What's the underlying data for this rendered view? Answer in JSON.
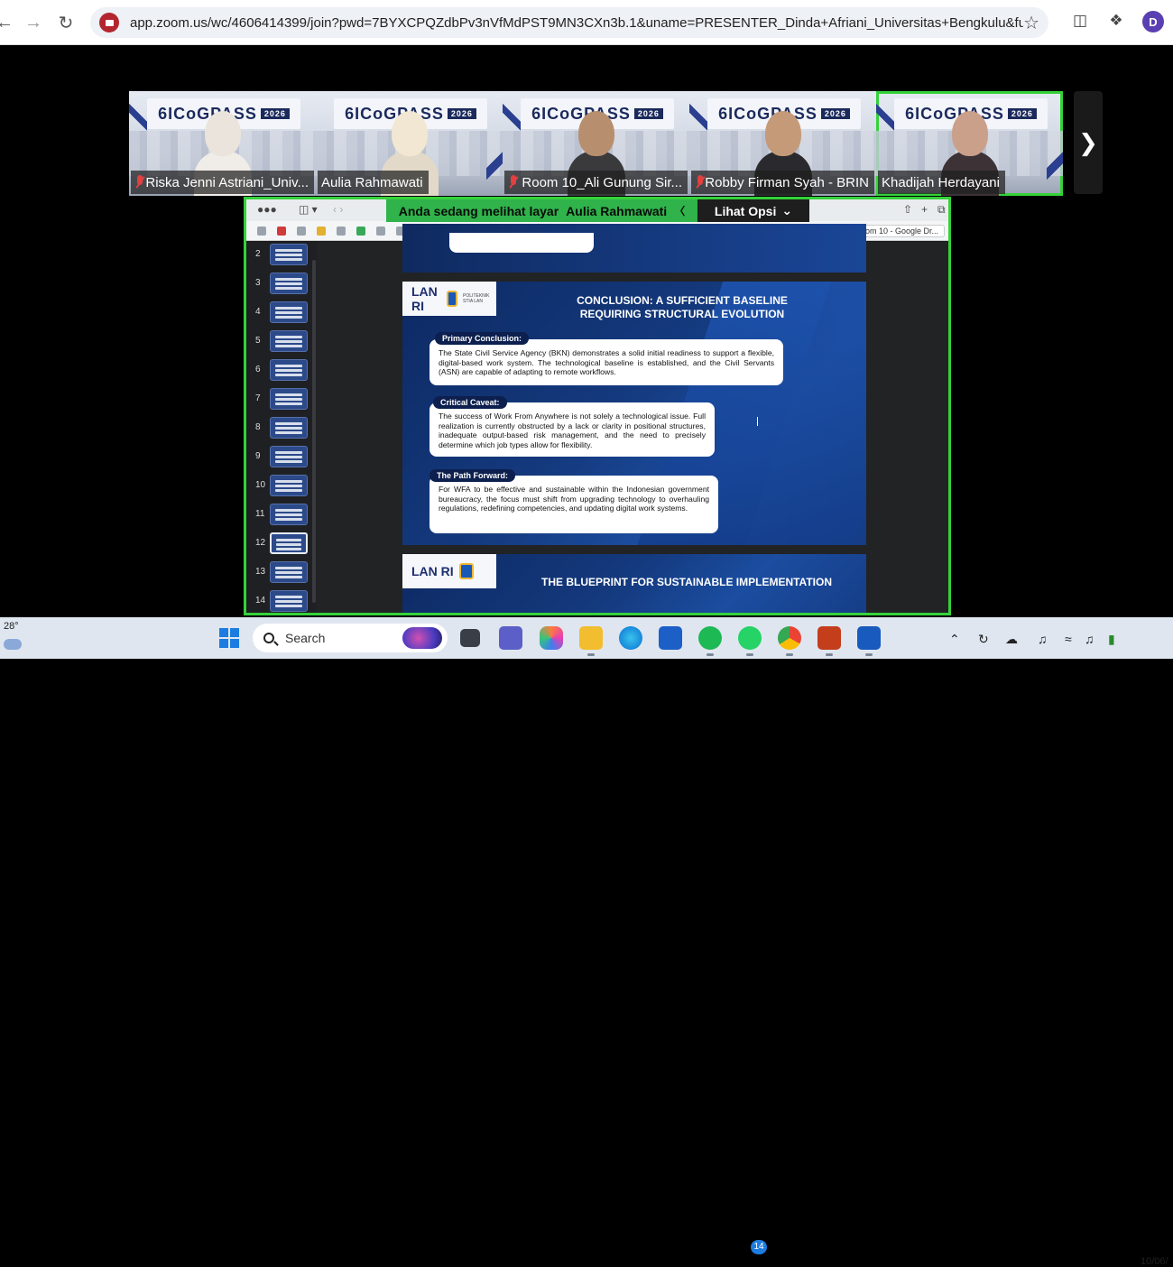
{
  "browser": {
    "url": "app.zoom.us/wc/4606414399/join?pwd=7BYXCPQZdbPv3nVfMdPST9MN3CXn3b.1&uname=PRESENTER_Dinda+Afriani_Universitas+Bengkulu&futoken=DHL...",
    "profile_initial": "D"
  },
  "participants": [
    {
      "name": "Riska Jenni Astriani_Univ...",
      "muted": true,
      "banner": "6ICoGPASS",
      "year": "2026"
    },
    {
      "name": "Aulia Rahmawati",
      "muted": false,
      "banner": "6ICoGPASS",
      "year": "2026"
    },
    {
      "name": "Room 10_Ali Gunung Sir...",
      "muted": true,
      "banner": "6ICoGPASS",
      "year": "2026"
    },
    {
      "name": "Robby Firman Syah - BRIN",
      "muted": true,
      "banner": "6ICoGPASS",
      "year": "2026"
    },
    {
      "name": "Khadijah Herdayani",
      "muted": false,
      "banner": "6ICoGPASS",
      "year": "2026",
      "active": true
    }
  ],
  "share": {
    "viewing_label": "Anda sedang melihat layar",
    "presenter": "Aulia Rahmawati",
    "options_label": "Lihat Opsi",
    "tab_chip": "Room 10 - Google Dr..."
  },
  "thumbnails": [
    "2",
    "3",
    "4",
    "5",
    "6",
    "7",
    "8",
    "9",
    "10",
    "11",
    "12",
    "13",
    "14"
  ],
  "selected_thumbnail": "12",
  "slide": {
    "logo_text": "LAN RI",
    "logo_right": "POLITEKNIK STIA LAN",
    "title_line1": "CONCLUSION: A SUFFICIENT BASELINE",
    "title_line2": "REQUIRING STRUCTURAL EVOLUTION",
    "sections": [
      {
        "label": "Primary Conclusion:",
        "text": "The State Civil Service Agency (BKN) demonstrates a solid initial readiness to support a flexible, digital-based work system. The technological baseline is established, and the Civil Servants (ASN) are capable of adapting to remote workflows."
      },
      {
        "label": "Critical Caveat:",
        "text": "The success of Work From Anywhere is not solely a technological issue. Full realization is currently obstructed by a lack or clarity in positional structures, inadequate output-based risk management, and the need to precisely determine which job types allow for flexibility."
      },
      {
        "label": "The Path Forward:",
        "text": "For WFA to be effective and sustainable within the Indonesian government bureaucracy, the focus must shift from upgrading technology to overhauling regulations, redefining competencies, and updating digital work systems."
      }
    ]
  },
  "next_slide": {
    "logo_text": "LAN RI",
    "title": "THE BLUEPRINT FOR SUSTAINABLE IMPLEMENTATION"
  },
  "taskbar": {
    "temperature": "28°",
    "search_placeholder": "Search",
    "whatsapp_badge": "14",
    "date": "10/06/"
  }
}
